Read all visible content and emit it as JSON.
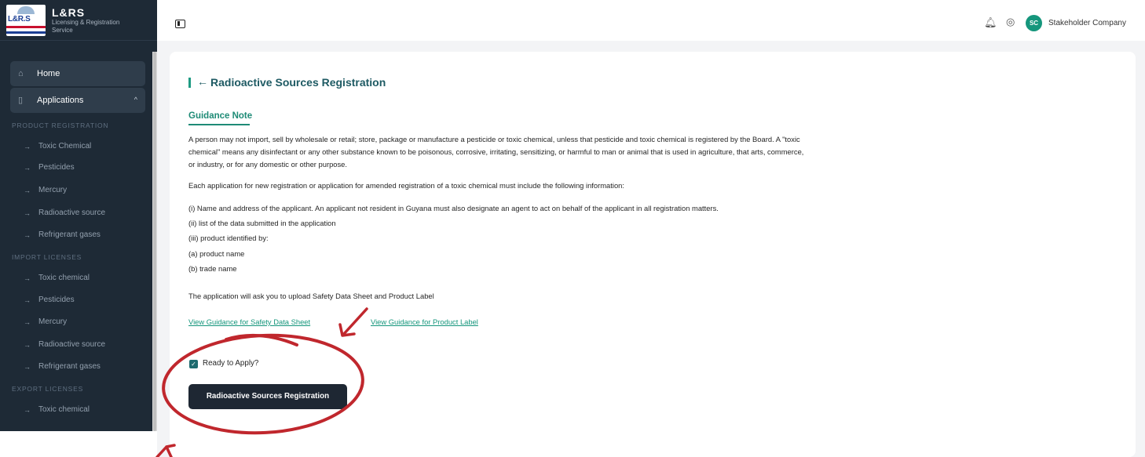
{
  "brand": {
    "title": "L&RS",
    "subtitle": "Licensing & Registration Service",
    "logo_text": "L&R.S"
  },
  "sidebar": {
    "home": "Home",
    "applications": "Applications",
    "sections": [
      {
        "title": "PRODUCT REGISTRATION",
        "items": [
          "Toxic Chemical",
          "Pesticides",
          "Mercury",
          "Radioactive source",
          "Refrigerant gases"
        ]
      },
      {
        "title": "IMPORT LICENSES",
        "items": [
          "Toxic chemical",
          "Pesticides",
          "Mercury",
          "Radioactive source",
          "Refrigerant gases"
        ]
      },
      {
        "title": "EXPORT LICENSES",
        "items": [
          "Toxic chemical"
        ]
      }
    ]
  },
  "topbar": {
    "avatar_initials": "SC",
    "user_name": "Stakeholder Company"
  },
  "page": {
    "title": "Radioactive Sources Registration",
    "guidance_title": "Guidance Note",
    "para1_line1": "A person may not import, sell by wholesale or retail; store, package or manufacture a pesticide or toxic chemical, unless that pesticide and toxic chemical is registered by the Board. A \"toxic",
    "para1_line2": "chemical\" means any disinfectant or any other substance known to be poisonous, corrosive, irritating, sensitizing, or harmful to man or animal that is used in agriculture, that arts, commerce,",
    "para1_line3": "or industry, or for any domestic or other purpose.",
    "para2": "Each application for new registration or application for amended registration of a toxic chemical must include the following information:",
    "list": [
      "(i) Name and address of the applicant. An applicant not resident in Guyana must also designate an agent to act on behalf of the applicant in all registration matters.",
      "(ii) list of the data submitted in the application",
      "(iii) product identified by:",
      "(a) product name",
      "(b) trade name"
    ],
    "upload_note": "The application will ask you to upload Safety Data Sheet and Product Label",
    "link_sds": "View Guidance for Safety Data Sheet",
    "link_label": "View Guidance for Product Label",
    "ready_label": "Ready to Apply?",
    "ready_checked": true,
    "submit_label": "Radioactive Sources Registration"
  },
  "colors": {
    "sidebar": "#1e2a36",
    "accent": "#15967c",
    "heading": "#1e5a63",
    "button": "#1e2733",
    "annotation": "#c0272d"
  }
}
